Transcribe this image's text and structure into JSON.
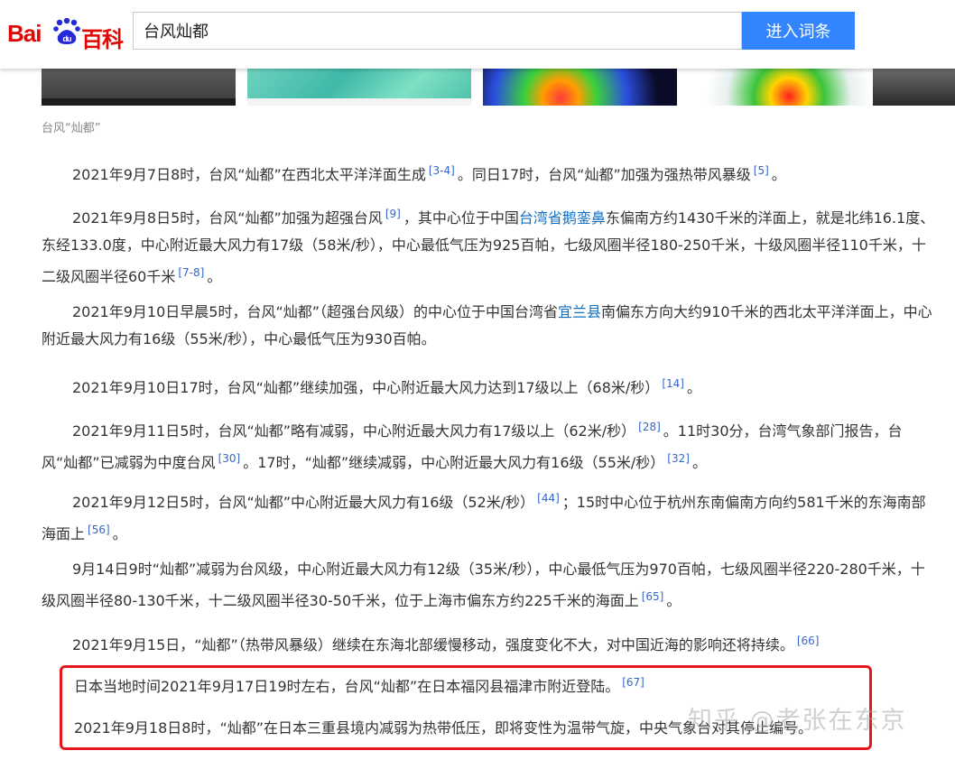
{
  "header": {
    "logo_bai": "Bai",
    "logo_du": "du",
    "logo_baike": "百科",
    "search_value": "台风灿都",
    "search_button": "进入词条"
  },
  "caption": "台风“灿都”",
  "paragraphs": [
    {
      "parts": [
        {
          "t": "2021年9月7日8时，台风“灿都”在西北太平洋洋面生成"
        },
        {
          "ref": "[3-4]"
        },
        {
          "t": "。同日17时，台风“灿都”加强为强热带风暴级"
        },
        {
          "ref": "[5]"
        },
        {
          "t": "。"
        }
      ]
    },
    {
      "parts": [
        {
          "t": "2021年9月8日5时，台风“灿都”加强为超强台风"
        },
        {
          "ref": "[9]"
        },
        {
          "t": "，其中心位于中国"
        },
        {
          "link": "台湾省鹅銮鼻"
        },
        {
          "t": "东偏南方约1430千米的洋面上，就是北纬16.1度、东经133.0度，中心附近最大风力有17级（58米/秒），中心最低气压为925百帕，七级风圈半径180-250千米，十级风圈半径110千米，十二级风圈半径60千米"
        },
        {
          "ref": "[7-8]"
        },
        {
          "t": "。"
        }
      ]
    },
    {
      "parts": [
        {
          "t": "2021年9月10日早晨5时，台风“灿都”（超强台风级）的中心位于中国台湾省"
        },
        {
          "link": "宜兰县"
        },
        {
          "t": "南偏东方向大约910千米的西北太平洋洋面上，中心附近最大风力有16级（55米/秒），中心最低气压为930百帕。"
        }
      ]
    },
    {
      "parts": [
        {
          "t": "2021年9月10日17时，台风“灿都”继续加强，中心附近最大风力达到17级以上（68米/秒）"
        },
        {
          "ref": "[14]"
        },
        {
          "t": "。"
        }
      ]
    },
    {
      "parts": [
        {
          "t": "2021年9月11日5时，台风“灿都”略有减弱，中心附近最大风力有17级以上（62米/秒）"
        },
        {
          "ref": "[28]"
        },
        {
          "t": "。11时30分，台湾气象部门报告，台风“灿都”已减弱为中度台风"
        },
        {
          "ref": "[30]"
        },
        {
          "t": "。17时，“灿都”继续减弱，中心附近最大风力有16级（55米/秒）"
        },
        {
          "ref": "[32]"
        },
        {
          "t": "。"
        }
      ]
    },
    {
      "parts": [
        {
          "t": "2021年9月12日5时，台风“灿都”中心附近最大风力有16级（52米/秒）"
        },
        {
          "ref": "[44]"
        },
        {
          "t": "；15时中心位于杭州东南偏南方向约581千米的东海南部海面上"
        },
        {
          "ref": "[56]"
        },
        {
          "t": "。"
        }
      ]
    },
    {
      "parts": [
        {
          "t": "9月14日9时“灿都”减弱为台风级，中心附近最大风力有12级（35米/秒），中心最低气压为970百帕，七级风圈半径220-280千米，十级风圈半径80-130千米，十二级风圈半径30-50千米，位于上海市偏东方约225千米的海面上"
        },
        {
          "ref": "[65]"
        },
        {
          "t": "。"
        }
      ]
    },
    {
      "parts": [
        {
          "t": "2021年9月15日，“灿都”（热带风暴级）继续在东海北部缓慢移动，强度变化不大，对中国近海的影响还将持续。"
        },
        {
          "ref": "[66]"
        }
      ]
    },
    {
      "parts": [
        {
          "t": "日本当地时间2021年9月17日19时左右，台风“灿都”在日本福冈县福津市附近登陆。"
        },
        {
          "ref": "[67]"
        }
      ]
    },
    {
      "parts": [
        {
          "t": "2021年9月18日8时，“灿都”在日本三重县境内减弱为热带低压，即将变性为温带气旋，中央气象台对其停止编号。"
        }
      ]
    }
  ],
  "watermark": "知乎 @老张在东京",
  "colors": {
    "accent": "#3385ff",
    "link": "#136ec2",
    "ref": "#3366cc",
    "highlight": "#e5161d",
    "brand": "#e10601"
  }
}
